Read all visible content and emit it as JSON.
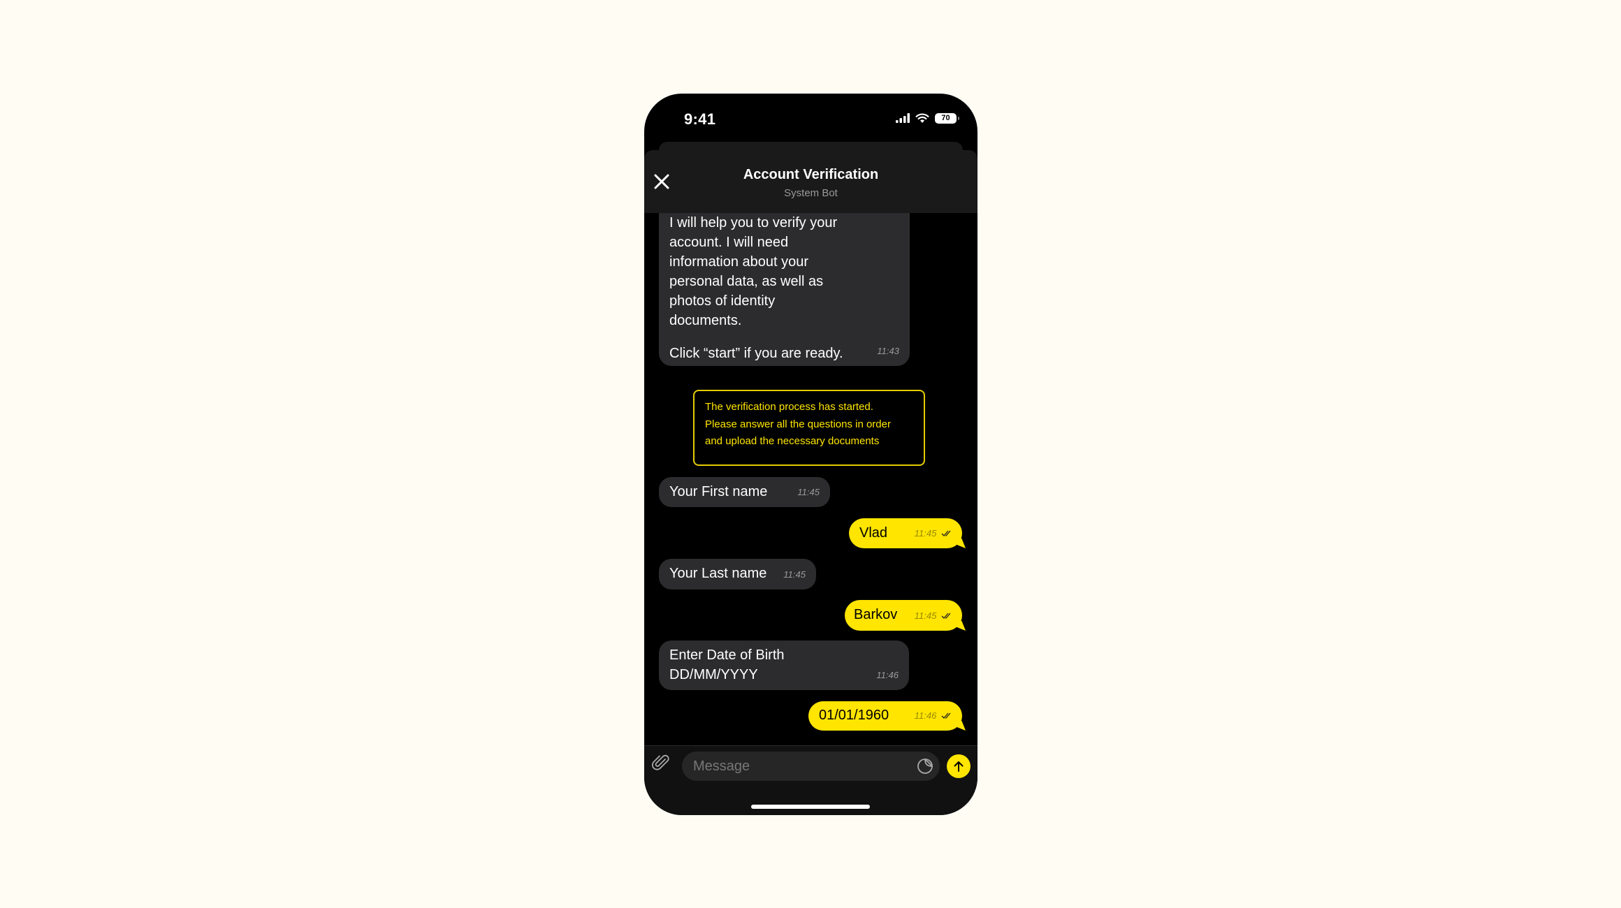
{
  "status_bar": {
    "time": "9:41",
    "battery": "70",
    "icons": [
      "cellular-signal-icon",
      "wifi-icon",
      "battery-icon"
    ]
  },
  "header": {
    "title": "Account Verification",
    "subtitle": "System Bot",
    "close_icon": "close-icon"
  },
  "messages": [
    {
      "sender": "bot",
      "lines": [
        "I will help you to verify your",
        "account. I will need",
        "information about your",
        "personal data, as well as",
        "photos of identity",
        "documents.",
        "",
        "Click “start” if you are ready."
      ],
      "time": "11:43"
    },
    {
      "sender": "system",
      "lines": [
        "The verification process has started.",
        "Please answer all the questions in order",
        "and upload the necessary documents"
      ]
    },
    {
      "sender": "bot",
      "text": "Your First name",
      "time": "11:45"
    },
    {
      "sender": "user",
      "text": "Vlad",
      "time": "11:45",
      "status": "read"
    },
    {
      "sender": "bot",
      "text": "Your Last name",
      "time": "11:45"
    },
    {
      "sender": "user",
      "text": "Barkov",
      "time": "11:45",
      "status": "read"
    },
    {
      "sender": "bot",
      "lines": [
        "Enter Date of Birth",
        "DD/MM/YYYY"
      ],
      "time": "11:46"
    },
    {
      "sender": "user",
      "text": "01/01/1960",
      "time": "11:46",
      "status": "read"
    }
  ],
  "composer": {
    "placeholder": "Message",
    "value": "",
    "attach_icon": "paperclip-icon",
    "sticker_icon": "sticker-icon",
    "send_icon": "arrow-up-icon"
  },
  "colors": {
    "accent": "#FFE500",
    "bot_bubble": "#2C2C2E",
    "background": "#000000",
    "page_background": "#FFFCF4"
  }
}
